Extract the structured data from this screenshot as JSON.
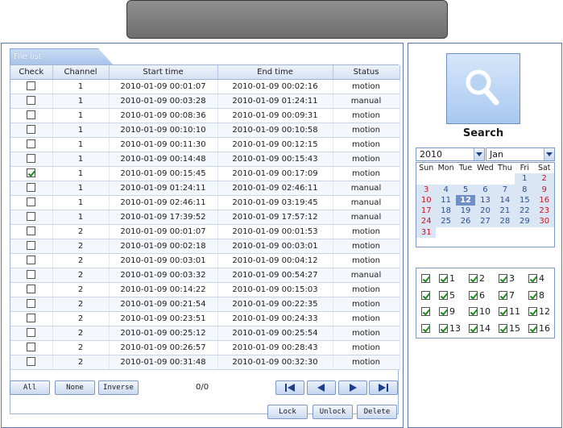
{
  "title_bar": {
    "text": ""
  },
  "file_list": {
    "tab_label": "File list",
    "columns": [
      "Check",
      "Channel",
      "Start time",
      "End time",
      "Status"
    ],
    "rows": [
      {
        "checked": false,
        "channel": "1",
        "start": "2010-01-09 00:01:07",
        "end": "2010-01-09 00:02:16",
        "status": "motion"
      },
      {
        "checked": false,
        "channel": "1",
        "start": "2010-01-09 00:03:28",
        "end": "2010-01-09 01:24:11",
        "status": "manual"
      },
      {
        "checked": false,
        "channel": "1",
        "start": "2010-01-09 00:08:36",
        "end": "2010-01-09 00:09:31",
        "status": "motion"
      },
      {
        "checked": false,
        "channel": "1",
        "start": "2010-01-09 00:10:10",
        "end": "2010-01-09 00:10:58",
        "status": "motion"
      },
      {
        "checked": false,
        "channel": "1",
        "start": "2010-01-09 00:11:30",
        "end": "2010-01-09 00:12:15",
        "status": "motion"
      },
      {
        "checked": false,
        "channel": "1",
        "start": "2010-01-09 00:14:48",
        "end": "2010-01-09 00:15:43",
        "status": "motion"
      },
      {
        "checked": true,
        "channel": "1",
        "start": "2010-01-09 00:15:45",
        "end": "2010-01-09 00:17:09",
        "status": "motion"
      },
      {
        "checked": false,
        "channel": "1",
        "start": "2010-01-09 01:24:11",
        "end": "2010-01-09 02:46:11",
        "status": "manual"
      },
      {
        "checked": false,
        "channel": "1",
        "start": "2010-01-09 02:46:11",
        "end": "2010-01-09 03:19:45",
        "status": "manual"
      },
      {
        "checked": false,
        "channel": "1",
        "start": "2010-01-09 17:39:52",
        "end": "2010-01-09 17:57:12",
        "status": "manual"
      },
      {
        "checked": false,
        "channel": "2",
        "start": "2010-01-09 00:01:07",
        "end": "2010-01-09 00:01:53",
        "status": "motion"
      },
      {
        "checked": false,
        "channel": "2",
        "start": "2010-01-09 00:02:18",
        "end": "2010-01-09 00:03:01",
        "status": "motion"
      },
      {
        "checked": false,
        "channel": "2",
        "start": "2010-01-09 00:03:01",
        "end": "2010-01-09 00:04:12",
        "status": "motion"
      },
      {
        "checked": false,
        "channel": "2",
        "start": "2010-01-09 00:03:32",
        "end": "2010-01-09 00:54:27",
        "status": "manual"
      },
      {
        "checked": false,
        "channel": "2",
        "start": "2010-01-09 00:14:22",
        "end": "2010-01-09 00:15:03",
        "status": "motion"
      },
      {
        "checked": false,
        "channel": "2",
        "start": "2010-01-09 00:21:54",
        "end": "2010-01-09 00:22:35",
        "status": "motion"
      },
      {
        "checked": false,
        "channel": "2",
        "start": "2010-01-09 00:23:51",
        "end": "2010-01-09 00:24:33",
        "status": "motion"
      },
      {
        "checked": false,
        "channel": "2",
        "start": "2010-01-09 00:25:12",
        "end": "2010-01-09 00:25:54",
        "status": "motion"
      },
      {
        "checked": false,
        "channel": "2",
        "start": "2010-01-09 00:26:57",
        "end": "2010-01-09 00:28:43",
        "status": "motion"
      },
      {
        "checked": false,
        "channel": "2",
        "start": "2010-01-09 00:31:48",
        "end": "2010-01-09 00:32:30",
        "status": "motion"
      }
    ]
  },
  "buttons": {
    "all": "All",
    "none": "None",
    "inverse": "Inverse",
    "lock": "Lock",
    "unlock": "Unlock",
    "delete": "Delete"
  },
  "pagination": {
    "count": "0/0"
  },
  "search": {
    "label": "Search",
    "icon": "magnifier-icon"
  },
  "calendar": {
    "year": "2010",
    "month": "Jan",
    "weekdays": [
      "Sun",
      "Mon",
      "Tue",
      "Wed",
      "Thu",
      "Fri",
      "Sat"
    ],
    "weeks": [
      [
        "",
        "",
        "",
        "",
        "",
        "1",
        "2"
      ],
      [
        "3",
        "4",
        "5",
        "6",
        "7",
        "8",
        "9"
      ],
      [
        "10",
        "11",
        "12",
        "13",
        "14",
        "15",
        "16"
      ],
      [
        "17",
        "18",
        "19",
        "20",
        "21",
        "22",
        "23"
      ],
      [
        "24",
        "25",
        "26",
        "27",
        "28",
        "29",
        "30"
      ],
      [
        "31",
        "",
        "",
        "",
        "",
        "",
        ""
      ]
    ],
    "selected_day": "12",
    "colors": {
      "weekend": "#c8141e",
      "weekday": "#2b4f8e",
      "selected_bg": "#6f8fc6"
    }
  },
  "channels": {
    "all_checked": true,
    "items": [
      {
        "label": "1",
        "checked": true
      },
      {
        "label": "2",
        "checked": true
      },
      {
        "label": "3",
        "checked": true
      },
      {
        "label": "4",
        "checked": true
      },
      {
        "label": "5",
        "checked": true
      },
      {
        "label": "6",
        "checked": true
      },
      {
        "label": "7",
        "checked": true
      },
      {
        "label": "8",
        "checked": true
      },
      {
        "label": "9",
        "checked": true
      },
      {
        "label": "10",
        "checked": true
      },
      {
        "label": "11",
        "checked": true
      },
      {
        "label": "12",
        "checked": true
      },
      {
        "label": "13",
        "checked": true
      },
      {
        "label": "14",
        "checked": true
      },
      {
        "label": "15",
        "checked": true
      },
      {
        "label": "16",
        "checked": true
      }
    ]
  }
}
